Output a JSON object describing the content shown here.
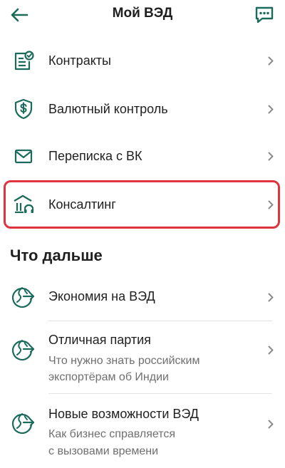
{
  "header": {
    "title": "Мой ВЭД"
  },
  "menu": [
    {
      "label": "Контракты",
      "icon": "contract-icon"
    },
    {
      "label": "Валютный контроль",
      "icon": "shield-dollar-icon"
    },
    {
      "label": "Переписка с ВК",
      "icon": "envelope-icon"
    },
    {
      "label": "Консалтинг",
      "icon": "consulting-bank-icon"
    }
  ],
  "section": {
    "title": "Что дальше"
  },
  "articles": [
    {
      "title": "Экономия на ВЭД",
      "sub1": "",
      "sub2": ""
    },
    {
      "title": "Отличная партия",
      "sub1": "Что нужно знать российским",
      "sub2": "экспортёрам об Индии"
    },
    {
      "title": "Новые возможности ВЭД",
      "sub1": "Как бизнес справляется",
      "sub2": "с вызовами времени"
    }
  ],
  "colors": {
    "accent": "#1a6b5a",
    "highlight": "#e03340",
    "chevron": "#8a8a8a"
  }
}
